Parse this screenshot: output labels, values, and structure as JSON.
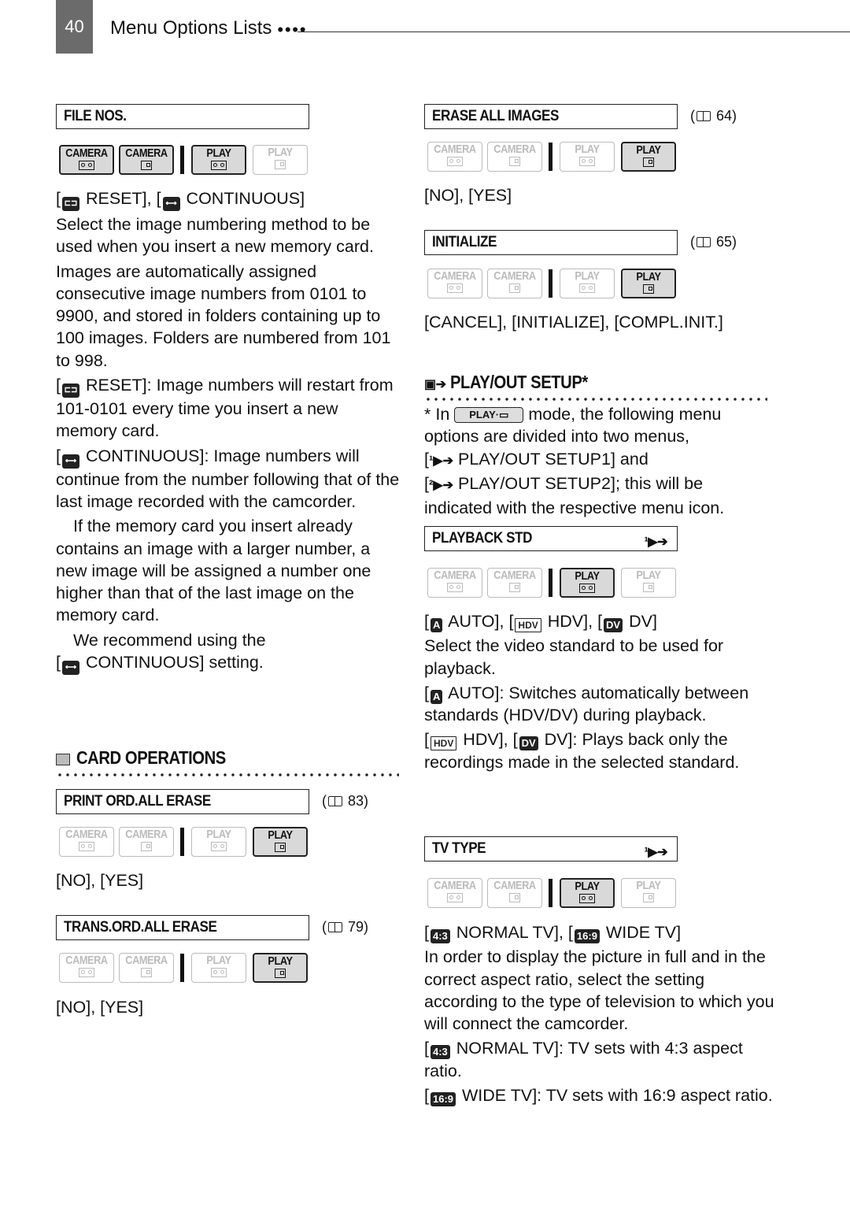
{
  "header": {
    "page_number": "40",
    "running_title": "Menu Options Lists",
    "dots": "●●●●"
  },
  "modes": {
    "camera_label": "CAMERA",
    "play_label": "PLAY"
  },
  "left": {
    "file_nos": {
      "title": "FILE NOS.",
      "options": {
        "reset": "RESET",
        "continuous": "CONTINUOUS"
      },
      "active_modes": [
        "camera-tape",
        "camera-card",
        "play-tape"
      ],
      "paragraphs": [
        "Select the image numbering method to be used when you insert a new memory card.",
        "Images are automatically assigned consecutive image numbers from 0101 to 9900, and stored in folders containing up to 100 images. Folders are numbered from 101 to 998."
      ],
      "reset_desc": "RESET]: Image numbers will restart from 101-0101 every time you insert a new memory card.",
      "continuous_desc": "CONTINUOUS]: Image numbers will continue from the number following that of the last image recorded with the camcorder.",
      "note1": "If the memory card you insert already contains an image with a larger number, a new image will be assigned a number one higher than that of the last image on the memory card.",
      "note2a": "We recommend using the",
      "note2b": "CONTINUOUS] setting."
    },
    "card_operations": {
      "section_title": "CARD OPERATIONS",
      "items": [
        {
          "title": "PRINT ORD.ALL ERASE",
          "page_ref": "83",
          "options": "[NO], [YES]",
          "active_modes": [
            "play-card"
          ]
        },
        {
          "title": "TRANS.ORD.ALL ERASE",
          "page_ref": "79",
          "options": "[NO], [YES]",
          "active_modes": [
            "play-card"
          ]
        }
      ]
    }
  },
  "right": {
    "erase_all": {
      "title": "ERASE ALL IMAGES",
      "page_ref": "64",
      "options": "[NO], [YES]",
      "active_modes": [
        "play-card"
      ]
    },
    "initialize": {
      "title": "INITIALIZE",
      "page_ref": "65",
      "options": "[CANCEL], [INITIALIZE], [COMPL.INIT.]",
      "active_modes": [
        "play-card"
      ]
    },
    "playout": {
      "section_title": "PLAY/OUT SETUP*",
      "note_prefix": "* In",
      "note_mode": "PLAY·",
      "note_rest": "mode, the following menu options are divided into two menus,",
      "menu1": "PLAY/OUT SETUP1] and",
      "menu2": "PLAY/OUT SETUP2]; this will be indicated with the respective menu icon."
    },
    "playback_std": {
      "title": "PLAYBACK STD",
      "active_modes": [
        "play-tape"
      ],
      "opt_auto": "AUTO],",
      "opt_hdv": "HDV],",
      "opt_dv": "DV]",
      "desc": "Select the video standard to be used for playback.",
      "auto_desc": "AUTO]: Switches automatically between standards (HDV/DV) during playback.",
      "hdv_desc_a": "HDV], [",
      "hdv_desc_b": "DV]: Plays back only the recordings made in the selected standard.",
      "icons": {
        "auto": "A",
        "hdv": "HDV",
        "dv": "DV"
      }
    },
    "tv_type": {
      "title": "TV TYPE",
      "active_modes": [
        "play-tape"
      ],
      "opt_normal": "NORMAL TV], [",
      "opt_wide": "WIDE TV]",
      "desc": "In order to display the picture in full and in the correct aspect ratio, select the setting according to the type of television to which you will connect the camcorder.",
      "normal_desc": "NORMAL TV]: TV sets with 4:3 aspect ratio.",
      "wide_desc": "WIDE TV]: TV sets with 16:9 aspect ratio.",
      "icons": {
        "normal": "4:3",
        "wide": "16:9"
      }
    }
  }
}
